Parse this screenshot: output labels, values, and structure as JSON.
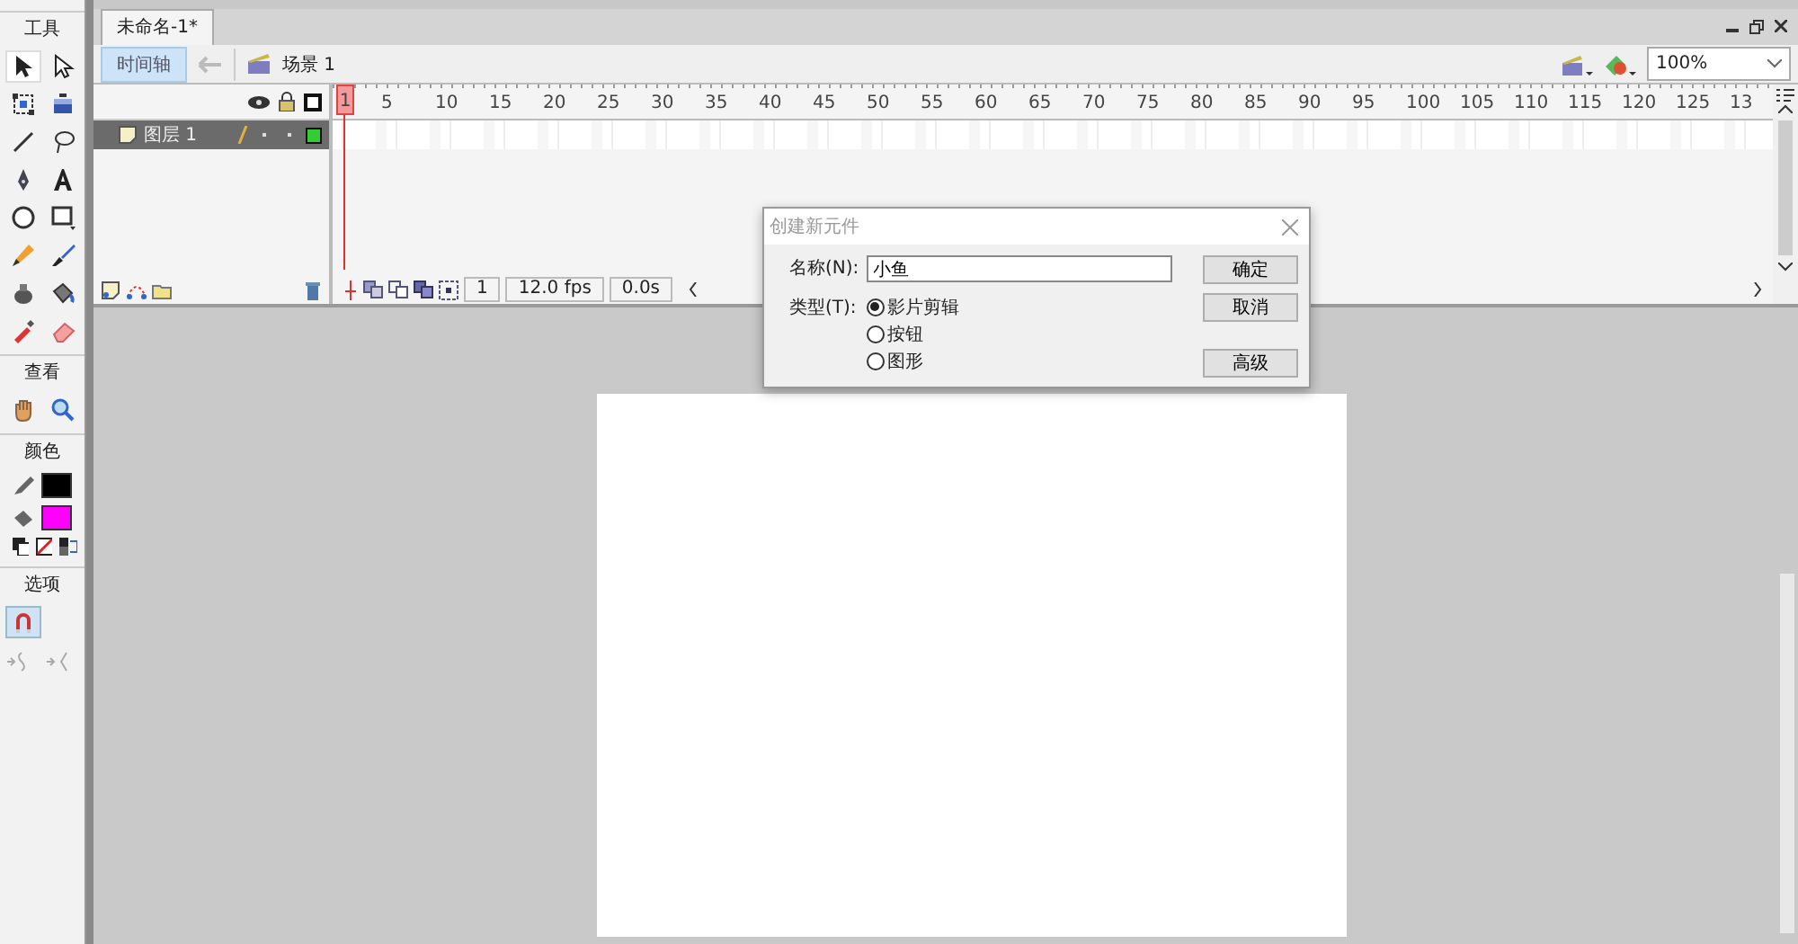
{
  "toolbox": {
    "sections": [
      {
        "title": "工具",
        "tools": [
          {
            "selected": true
          },
          {
            "selected": false
          },
          {
            "selected": false
          },
          {
            "selected": false
          },
          {
            "selected": false
          },
          {
            "selected": false
          },
          {
            "selected": false
          },
          {
            "selected": false
          },
          {
            "selected": false
          },
          {
            "selected": false
          },
          {
            "selected": false
          },
          {
            "selected": false
          },
          {
            "selected": false
          },
          {
            "selected": false
          },
          {
            "selected": false
          },
          {
            "selected": false
          }
        ]
      },
      {
        "title": "查看",
        "tools": [
          {
            "selected": false
          },
          {
            "selected": false
          }
        ]
      },
      {
        "title": "颜色",
        "swatches": [
          {
            "color": "#000000"
          },
          {
            "color": "#ff00ff"
          }
        ]
      },
      {
        "title": "选项",
        "tools": [
          {
            "selected": true
          }
        ]
      }
    ]
  },
  "document_tab": {
    "title": "未命名-1*"
  },
  "toolbar": {
    "timeline_button": {
      "label": "时间轴",
      "selected": true
    },
    "scene": "场景 1",
    "zoom": "100%"
  },
  "timeline": {
    "layers": [
      {
        "name": "图层 1",
        "selected": true
      }
    ],
    "ruler": [
      "1",
      "5",
      "10",
      "15",
      "20",
      "25",
      "30",
      "35",
      "40",
      "45",
      "50",
      "55",
      "60",
      "65",
      "70",
      "75",
      "80",
      "85",
      "90",
      "95",
      "100",
      "105",
      "110",
      "115",
      "120",
      "125",
      "13"
    ],
    "current_frame": "1",
    "frame_rate": "12.0 fps",
    "elapsed_time": "0.0s"
  },
  "dialog": {
    "title": "创建新元件",
    "name_label": "名称(N):",
    "name_value": "小鱼",
    "type_label": "类型(T):",
    "types": [
      {
        "label": "影片剪辑",
        "selected": true
      },
      {
        "label": "按钮",
        "selected": false
      },
      {
        "label": "图形",
        "selected": false
      }
    ],
    "buttons": [
      "确定",
      "取消",
      "高级"
    ]
  }
}
